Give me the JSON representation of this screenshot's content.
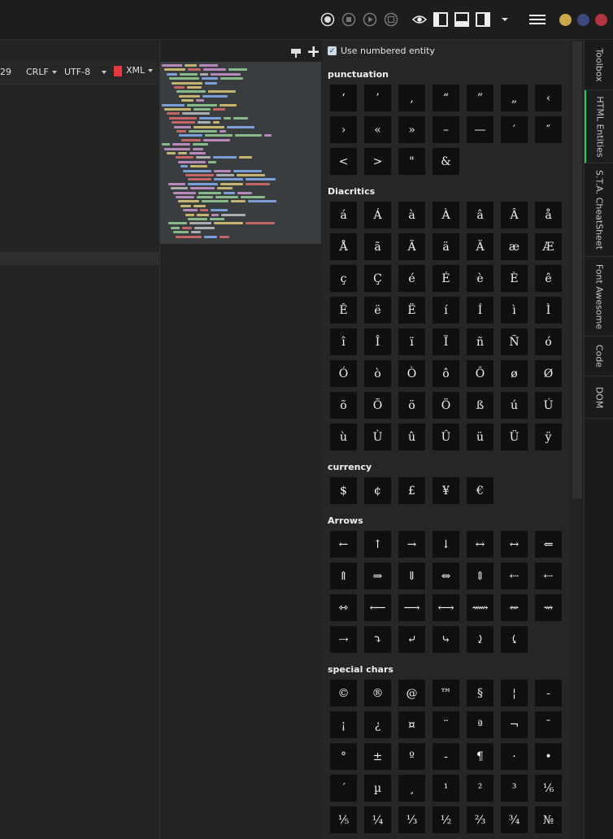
{
  "statusbar": {
    "line": "29",
    "line_ending": "CRLF",
    "encoding": "UTF-8",
    "language": "XML"
  },
  "toolbar_icons": [
    "record-icon",
    "stop-icon",
    "play-icon",
    "save-macro-icon",
    "eye-icon",
    "layout-left-icon",
    "layout-bottom-icon",
    "layout-right-icon",
    "chevron-down-icon",
    "hamburger-menu-icon"
  ],
  "window_dots": [
    {
      "name": "minimize",
      "color": "#c8a84b"
    },
    {
      "name": "maximize",
      "color": "#3d4a7a"
    },
    {
      "name": "close",
      "color": "#b2343f"
    }
  ],
  "accent_color": "#1bd66a",
  "panel": {
    "numbered_label": "Use numbered entity",
    "numbered_checked": true,
    "sections": [
      {
        "title": "punctuation",
        "chars": [
          "‘",
          "’",
          "‚",
          "“",
          "”",
          "„",
          "‹",
          "›",
          "«",
          "»",
          "–",
          "—",
          "′",
          "″",
          "<",
          ">",
          "\"",
          "&"
        ]
      },
      {
        "title": "Diacritics",
        "chars": [
          "á",
          "Á",
          "à",
          "À",
          "â",
          "Â",
          "å",
          "Å",
          "ã",
          "Ã",
          "ä",
          "Ä",
          "æ",
          "Æ",
          "ç",
          "Ç",
          "é",
          "É",
          "è",
          "È",
          "ê",
          "Ê",
          "ë",
          "Ë",
          "í",
          "Í",
          "ì",
          "Ì",
          "î",
          "Î",
          "ï",
          "Ï",
          "ñ",
          "Ñ",
          "ó",
          "Ó",
          "ò",
          "Ò",
          "ô",
          "Ô",
          "ø",
          "Ø",
          "õ",
          "Õ",
          "ö",
          "Ö",
          "ß",
          "ú",
          "Ú",
          "ù",
          "Ù",
          "û",
          "Û",
          "ü",
          "Ü",
          "ÿ"
        ]
      },
      {
        "title": "currency",
        "chars": [
          "$",
          "¢",
          "£",
          "¥",
          "€"
        ]
      },
      {
        "title": "Arrows",
        "chars": [
          "←",
          "↑",
          "→",
          "↓",
          "↔",
          "↔",
          "⇐",
          "⇑",
          "⇒",
          "⇓",
          "⇔",
          "⇕",
          "⇠",
          "⇠",
          "⇿",
          "⟵",
          "⟶",
          "⟷",
          "⟿",
          "⇜",
          "⇝",
          "⇢",
          "⤵",
          "⤶",
          "⤷",
          "⤸",
          "⤹"
        ]
      },
      {
        "title": "special chars",
        "chars": [
          "©",
          "®",
          "@",
          "™",
          "§",
          "¦",
          "-",
          "¡",
          "¿",
          "¤",
          "¨",
          "ª",
          "¬",
          "¯",
          "°",
          "±",
          "º",
          "-",
          "¶",
          "·",
          "•",
          "´",
          "µ",
          "¸",
          "¹",
          "²",
          "³",
          "⅙",
          "⅕",
          "¼",
          "⅓",
          "½",
          "⅔",
          "¾",
          "№"
        ]
      }
    ]
  },
  "side_tabs": [
    "Toolbox",
    "HTML Entities",
    "S.T.A. CheatSheet",
    "Font Awesome",
    "Code",
    "DOM"
  ]
}
